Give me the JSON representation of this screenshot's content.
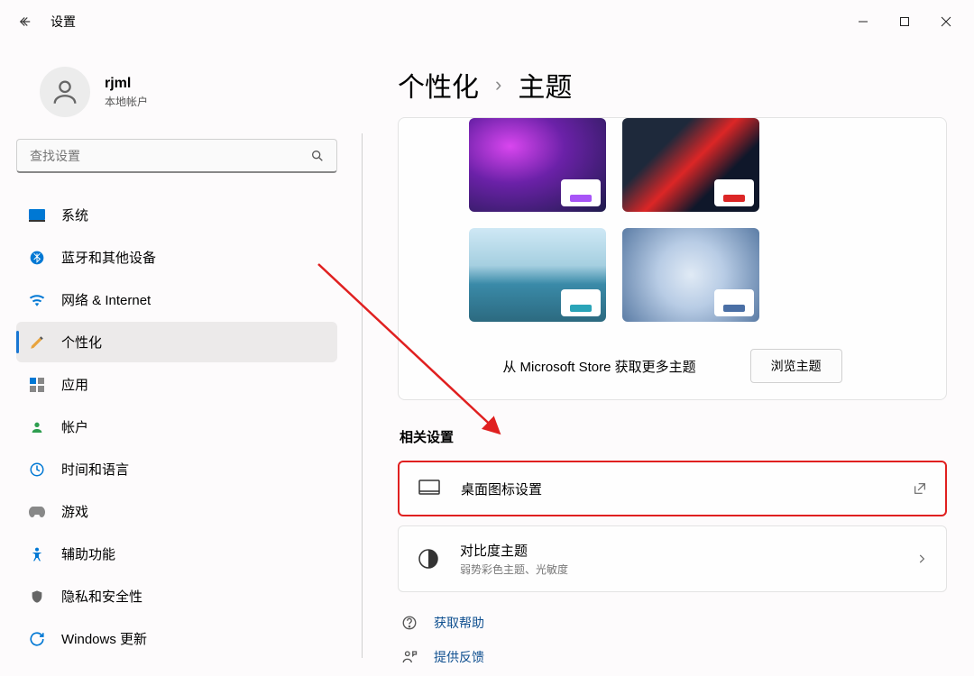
{
  "window": {
    "title": "设置"
  },
  "user": {
    "name": "rjml",
    "account_type": "本地帐户"
  },
  "search": {
    "placeholder": "查找设置"
  },
  "nav": {
    "items": [
      {
        "label": "系统"
      },
      {
        "label": "蓝牙和其他设备"
      },
      {
        "label": "网络 & Internet"
      },
      {
        "label": "个性化"
      },
      {
        "label": "应用"
      },
      {
        "label": "帐户"
      },
      {
        "label": "时间和语言"
      },
      {
        "label": "游戏"
      },
      {
        "label": "辅助功能"
      },
      {
        "label": "隐私和安全性"
      },
      {
        "label": "Windows 更新"
      }
    ]
  },
  "breadcrumb": {
    "parent": "个性化",
    "current": "主题"
  },
  "themes": {
    "store_text": "从 Microsoft Store 获取更多主题",
    "browse_button": "浏览主题"
  },
  "related": {
    "header": "相关设置",
    "desktop_icons": {
      "title": "桌面图标设置"
    },
    "contrast": {
      "title": "对比度主题",
      "sub": "弱势彩色主题、光敏度"
    }
  },
  "footer": {
    "help": "获取帮助",
    "feedback": "提供反馈"
  }
}
